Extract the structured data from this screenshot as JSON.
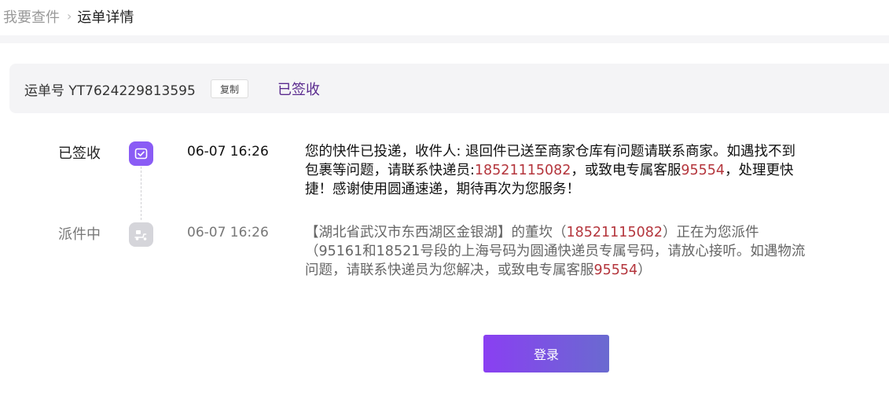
{
  "breadcrumb": {
    "parent": "我要查件",
    "separator": "›",
    "current": "运单详情"
  },
  "header": {
    "waybill_label": "运单号",
    "waybill_number": "YT7624229813595",
    "copy_label": "复制",
    "status": "已签收"
  },
  "timeline": [
    {
      "status": "已签收",
      "icon": "signed-check-icon",
      "time": "06-07 16:26",
      "segments": [
        "您的快件已投递，收件人: 退回件已送至商家仓库有问题请联系商家。如遇找不到包裹等问题，请联系快递员:",
        "18521115082",
        "，或致电专属客服",
        "95554",
        "，处理更快捷！感谢使用圆通速递，期待再次为您服务！"
      ]
    },
    {
      "status": "派件中",
      "icon": "delivery-scooter-icon",
      "time": "06-07 16:26",
      "segments": [
        "【湖北省武汉市东西湖区金银湖】的董坎（",
        "18521115082",
        "）正在为您派件（95161和18521号段的上海号码为圆通快递员专属号码，请放心接听。如遇物流问题，请联系快递员为您解决，或致电专属客服",
        "95554",
        "）"
      ]
    }
  ],
  "login_button": "登录",
  "colors": {
    "accent_purple": "#8a5cf5",
    "status_text": "#5a2a8e",
    "highlight_red": "#b4353c",
    "button_gradient_start": "#8a3ff2",
    "button_gradient_end": "#6a6ad0"
  }
}
